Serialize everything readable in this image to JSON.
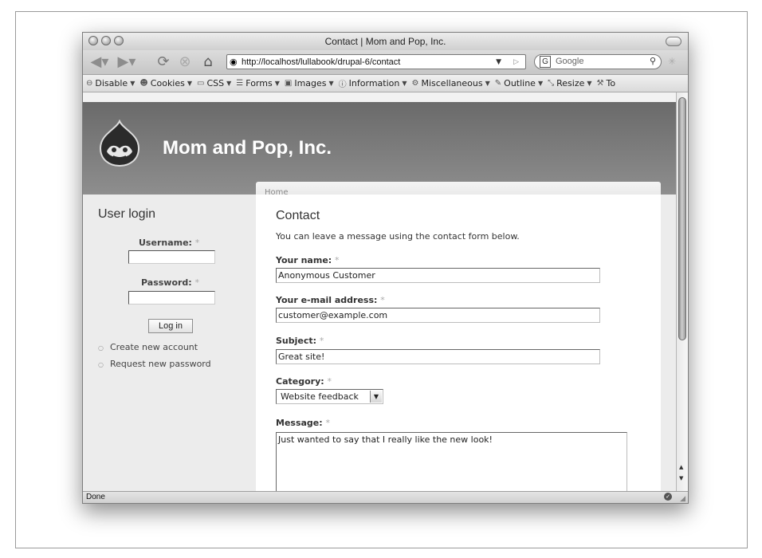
{
  "window": {
    "title": "Contact | Mom and Pop, Inc."
  },
  "nav": {
    "url": "http://localhost/lullabook/drupal-6/contact",
    "search_placeholder": "Google"
  },
  "devtoolbar": {
    "items": [
      {
        "label": "Disable",
        "icon": "disable-icon"
      },
      {
        "label": "Cookies",
        "icon": "cookies-icon"
      },
      {
        "label": "CSS",
        "icon": "css-icon"
      },
      {
        "label": "Forms",
        "icon": "forms-icon"
      },
      {
        "label": "Images",
        "icon": "images-icon"
      },
      {
        "label": "Information",
        "icon": "information-icon"
      },
      {
        "label": "Miscellaneous",
        "icon": "miscellaneous-icon"
      },
      {
        "label": "Outline",
        "icon": "outline-icon"
      },
      {
        "label": "Resize",
        "icon": "resize-icon"
      },
      {
        "label": "To",
        "icon": "tools-icon"
      }
    ]
  },
  "site": {
    "name": "Mom and Pop, Inc.",
    "breadcrumb": "Home"
  },
  "sidebar": {
    "title": "User login",
    "username_label": "Username:",
    "password_label": "Password:",
    "required_mark": "*",
    "login_button": "Log in",
    "links": [
      "Create new account",
      "Request new password"
    ]
  },
  "contact": {
    "title": "Contact",
    "intro": "You can leave a message using the contact form below.",
    "name_label": "Your name:",
    "name_value": "Anonymous Customer",
    "email_label": "Your e-mail address:",
    "email_value": "customer@example.com",
    "subject_label": "Subject:",
    "subject_value": "Great site!",
    "category_label": "Category:",
    "category_value": "Website feedback",
    "message_label": "Message:",
    "message_value": "Just wanted to say that I really like the new look!"
  },
  "status": {
    "text": "Done"
  }
}
